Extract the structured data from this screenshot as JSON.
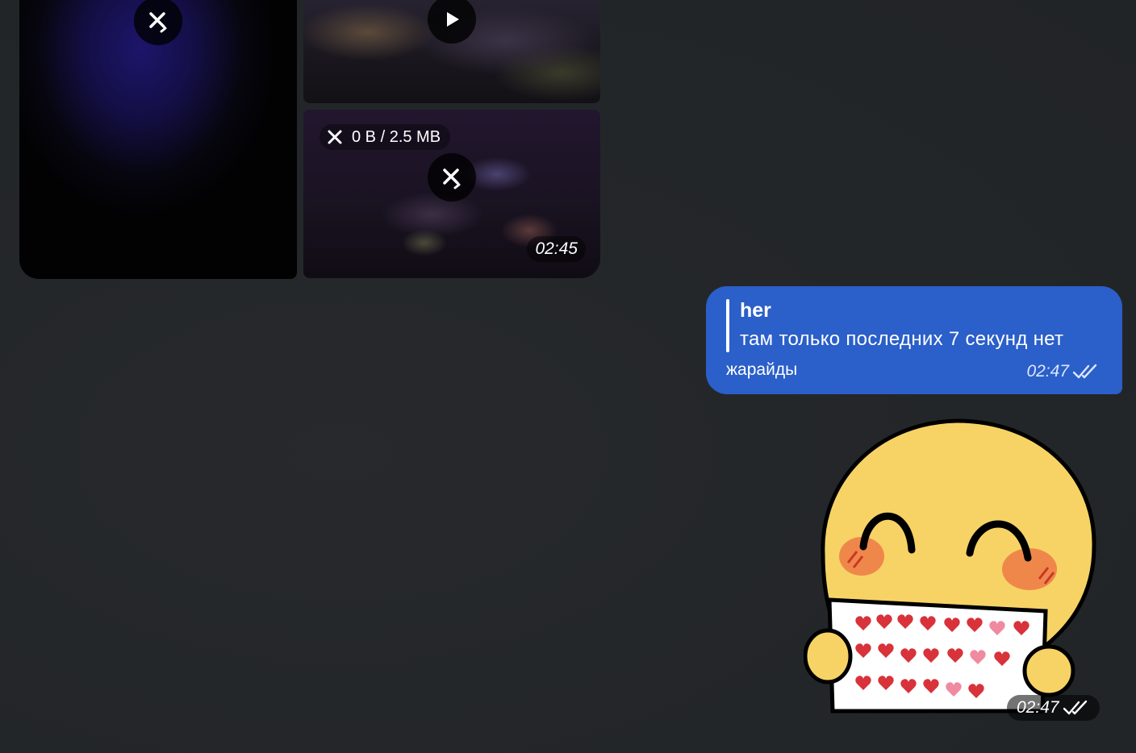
{
  "album": {
    "download_progress": "0 B / 2.5 MB",
    "video_time": "02:45",
    "icons": {
      "cancel_download": "close-icon",
      "play": "play-icon"
    }
  },
  "outgoing_message": {
    "reply_author": "her",
    "reply_text": "там только последних 7 секунд нет",
    "text": "жарайды",
    "time": "02:47",
    "status_icon": "double-check-icon",
    "bubble_color": "#2b5fc9"
  },
  "sticker_message": {
    "time": "02:47",
    "status_icon": "double-check-icon"
  },
  "colors": {
    "background": "#232629",
    "accent": "#2b5fc9"
  }
}
